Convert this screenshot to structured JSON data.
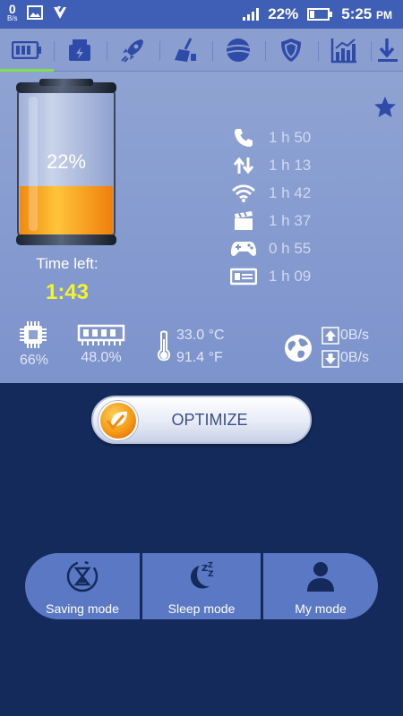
{
  "status_bar": {
    "net_speed_value": "0",
    "net_speed_unit": "B/s",
    "battery_percent": "22%",
    "time": "5:25",
    "ampm": "PM"
  },
  "tabs": [
    {
      "name": "battery",
      "icon": "battery-icon",
      "active": true
    },
    {
      "name": "charging",
      "icon": "charger-icon"
    },
    {
      "name": "boost",
      "icon": "rocket-icon"
    },
    {
      "name": "clean",
      "icon": "broom-icon"
    },
    {
      "name": "network",
      "icon": "globe-icon"
    },
    {
      "name": "protect",
      "icon": "shield-icon"
    },
    {
      "name": "stats",
      "icon": "bar-chart-icon"
    },
    {
      "name": "download",
      "icon": "download-icon"
    }
  ],
  "battery": {
    "percent_text": "22%",
    "level": 0.22,
    "time_left_label": "Time left:",
    "time_left_value": "1:43"
  },
  "usage": [
    {
      "icon": "phone-icon",
      "value": "1 h 50"
    },
    {
      "icon": "data-transfer-icon",
      "value": "1 h 13"
    },
    {
      "icon": "wifi-icon",
      "value": "1 h 42"
    },
    {
      "icon": "video-clapper-icon",
      "value": "1 h 37"
    },
    {
      "icon": "gamepad-icon",
      "value": "0 h 55"
    },
    {
      "icon": "radio-icon",
      "value": "1 h 09"
    }
  ],
  "stats": {
    "cpu_percent": "66%",
    "ram_percent": "48.0%",
    "temp_c": "33.0 °C",
    "temp_f": "91.4 °F",
    "upload_speed": "0B/s",
    "download_speed": "0B/s"
  },
  "optimize": {
    "label": "OPTIMIZE"
  },
  "modes": [
    {
      "label": "Saving mode",
      "icon": "hourglass-icon"
    },
    {
      "label": "Sleep mode",
      "icon": "moon-sleep-icon"
    },
    {
      "label": "My mode",
      "icon": "person-icon"
    }
  ],
  "colors": {
    "status_bar": "#3f5fb7",
    "panel": "#8a9ed0",
    "background": "#132a5b",
    "time_left_accent": "#f4f42a",
    "tab_active": "#7fe04a",
    "mode_button": "#5b78c4"
  }
}
